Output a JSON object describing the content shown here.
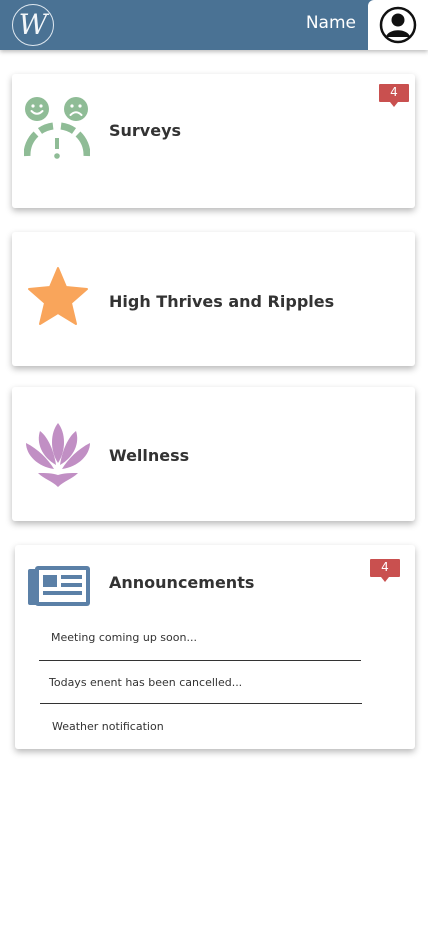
{
  "header": {
    "logo_letter": "W",
    "user_name": "Name"
  },
  "cards": [
    {
      "title": "Surveys",
      "badge": "4",
      "icon": "survey-faces-icon"
    },
    {
      "title": "High Thrives and Ripples",
      "icon": "star-icon"
    },
    {
      "title": "Wellness",
      "icon": "lotus-icon"
    },
    {
      "title": "Announcements",
      "badge": "4",
      "icon": "newspaper-icon",
      "items": [
        "Meeting coming up soon...",
        "Todays enent has been cancelled...",
        "Weather notification"
      ]
    }
  ],
  "colors": {
    "header": "#4a7294",
    "survey_icon": "#8fbc96",
    "star_icon": "#f9a55b",
    "lotus_icon": "#c18fc4",
    "newspaper_icon": "#5b80a7",
    "badge": "#c9504f"
  }
}
